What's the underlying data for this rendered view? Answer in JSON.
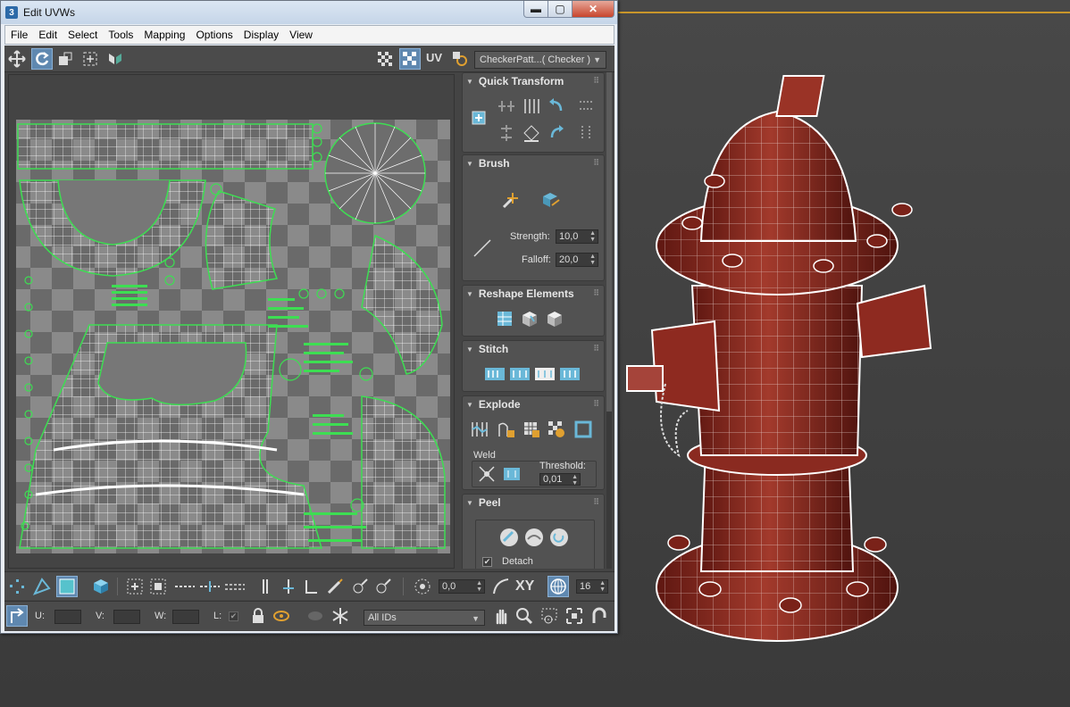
{
  "window": {
    "title": "Edit UVWs",
    "app_icon": "3",
    "minimize": "▬",
    "maximize": "▢",
    "close": "✕"
  },
  "menu": [
    "File",
    "Edit",
    "Select",
    "Tools",
    "Mapping",
    "Options",
    "Display",
    "View"
  ],
  "toolbar_top": {
    "uv_label": "UV",
    "checker_dropdown": "CheckerPatt...( Checker )"
  },
  "rollouts": {
    "quick_transform": {
      "title": "Quick Transform"
    },
    "brush": {
      "title": "Brush",
      "strength_label": "Strength:",
      "strength_value": "10,0",
      "falloff_label": "Falloff:",
      "falloff_value": "20,0"
    },
    "reshape": {
      "title": "Reshape Elements"
    },
    "stitch": {
      "title": "Stitch"
    },
    "explode": {
      "title": "Explode",
      "weld_label": "Weld",
      "threshold_label": "Threshold:",
      "threshold_value": "0,01"
    },
    "peel": {
      "title": "Peel",
      "detach_label": "Detach",
      "detach_checked": true
    }
  },
  "bottom_toolbar1": {
    "soft_value": "0,0",
    "xy_label": "XY",
    "grid_value": "16"
  },
  "bottom_toolbar2": {
    "u_label": "U:",
    "v_label": "V:",
    "w_label": "W:",
    "l_label": "L:",
    "ids_dropdown": "All IDs"
  },
  "colors": {
    "accent_blue": "#5f88b0",
    "uv_green": "#3dde52",
    "hydrant_red": "#8e2a20",
    "viewport_orange": "#c8962a"
  }
}
